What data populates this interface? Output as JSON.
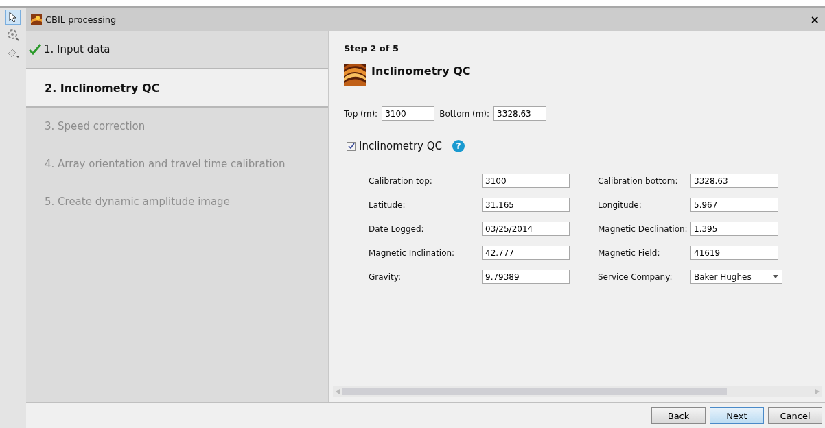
{
  "window": {
    "title": "CBIL processing",
    "close": "×"
  },
  "toolbar": [
    {
      "kind": "pointer",
      "selected": true
    },
    {
      "kind": "target",
      "selected": false
    },
    {
      "kind": "eraser",
      "selected": false
    }
  ],
  "steps": [
    {
      "label": "1. Input data",
      "done": true,
      "selected": false,
      "disabled": false
    },
    {
      "label": "2. Inclinometry QC",
      "done": false,
      "selected": true,
      "disabled": false
    },
    {
      "label": "3. Speed correction",
      "done": false,
      "selected": false,
      "disabled": true
    },
    {
      "label": "4. Array orientation and travel time calibration",
      "done": false,
      "selected": false,
      "disabled": true
    },
    {
      "label": "5. Create dynamic amplitude image",
      "done": false,
      "selected": false,
      "disabled": true
    }
  ],
  "step_counter": "Step 2 of 5",
  "heading": "Inclinometry QC",
  "range": [
    {
      "label": "Top (m):",
      "value": "3100"
    },
    {
      "label": "Bottom (m):",
      "value": "3328.63"
    }
  ],
  "qc_checkbox": {
    "label": "Inclinometry QC",
    "checked": true,
    "help": "?"
  },
  "fields": [
    {
      "label": "Calibration top:",
      "value": "3100",
      "kind": "text"
    },
    {
      "label": "Calibration bottom:",
      "value": "3328.63",
      "kind": "text"
    },
    {
      "label": "Latitude:",
      "value": "31.165",
      "kind": "text"
    },
    {
      "label": "Longitude:",
      "value": "5.967",
      "kind": "text"
    },
    {
      "label": "Date Logged:",
      "value": "03/25/2014",
      "kind": "text"
    },
    {
      "label": "Magnetic Declination:",
      "value": "1.395",
      "kind": "text"
    },
    {
      "label": "Magnetic Inclination:",
      "value": "42.777",
      "kind": "text"
    },
    {
      "label": "Magnetic Field:",
      "value": "41619",
      "kind": "text"
    },
    {
      "label": "Gravity:",
      "value": "9.79389",
      "kind": "text"
    },
    {
      "label": "Service Company:",
      "value": "Baker Hughes",
      "kind": "dropdown"
    }
  ],
  "buttons": [
    {
      "label": "Back",
      "selected": false
    },
    {
      "label": "Next",
      "selected": true
    },
    {
      "label": "Cancel",
      "selected": false
    }
  ]
}
